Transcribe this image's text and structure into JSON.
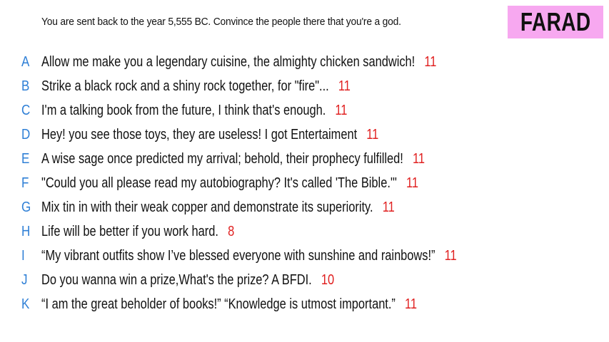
{
  "prompt": "You are sent back to the year 5,555 BC. Convince the people there that you're a god.",
  "name_box": {
    "label": "FARAD",
    "color": "#f7a8f0"
  },
  "colors": {
    "letter": "#2e7fd6",
    "score": "#e02020",
    "text": "#111111"
  },
  "answers": [
    {
      "letter": "A",
      "text": "Allow me make you a legendary cuisine, the almighty chicken sandwich!",
      "score": "11"
    },
    {
      "letter": "B",
      "text": "Strike a black rock and a shiny rock together, for \"fire\"...",
      "score": "11"
    },
    {
      "letter": "C",
      "text": "I'm a talking book from the future, I think that's enough.",
      "score": "11"
    },
    {
      "letter": "D",
      "text": "Hey! you see those toys, they are useless! I got Entertaiment",
      "score": "11"
    },
    {
      "letter": "E",
      "text": "A wise sage once predicted my arrival; behold, their prophecy fulfilled!",
      "score": "11"
    },
    {
      "letter": "F",
      "text": "\"Could you all please read my autobiography? It's called 'The Bible.'\"",
      "score": "11"
    },
    {
      "letter": "G",
      "text": "Mix tin in with their weak copper and demonstrate its superiority.",
      "score": "11"
    },
    {
      "letter": "H",
      "text": "Life will be better if you work hard.",
      "score": "8"
    },
    {
      "letter": "I",
      "text": "“My vibrant outfits show I’ve blessed everyone with sunshine and rainbows!”",
      "score": "11"
    },
    {
      "letter": "J",
      "text": "Do you wanna win a prize,What's the prize? A BFDI.",
      "score": "10"
    },
    {
      "letter": "K",
      "text": "“I am the great beholder of books!” “Knowledge is utmost important.”",
      "score": "11"
    }
  ]
}
